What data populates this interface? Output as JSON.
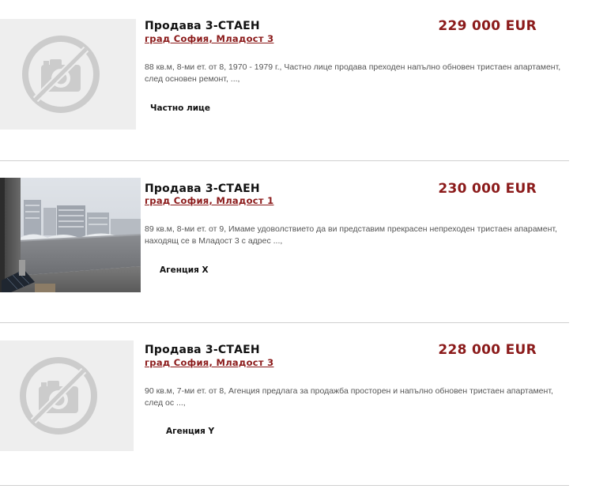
{
  "listings": [
    {
      "title": "Продава 3-СТАЕН",
      "location": "град София, Младост 3",
      "price": "229 000 EUR",
      "description": "88 кв.м, 8-ми ет. от 8, 1970 - 1979 г., Частно лице продава преходен напълно обновен тристаен апартамент, след основен ремонт, ...,",
      "seller": "Частно лице",
      "image": "no-photo-placeholder"
    },
    {
      "title": "Продава 3-СТАЕН",
      "location": "град София, Младост 1",
      "price": "230 000 EUR",
      "description": "89 кв.м, 8-ми ет. от 9, Имаме удоволствието да ви представим прекрасен непреходен тристаен апарамент, находящ се в Младост 3 с адрес ...,",
      "seller": "Агенция X",
      "image": "balcony-photo"
    },
    {
      "title": "Продава 3-СТАЕН",
      "location": "град София, Младост 3",
      "price": "228 000 EUR",
      "description": "90 кв.м, 7-ми ет. от 8, Агенция предлага за продажба просторен и напълно обновен тристаен апартамент, след ос ...,",
      "seller": "Агенция Y",
      "image": "no-photo-placeholder"
    }
  ],
  "colors": {
    "price": "#8b1a1a",
    "location": "#8b1a1a",
    "placeholder_bg": "#eeeeee",
    "placeholder_icon": "#cccccc",
    "divider": "#cfcfcf"
  }
}
